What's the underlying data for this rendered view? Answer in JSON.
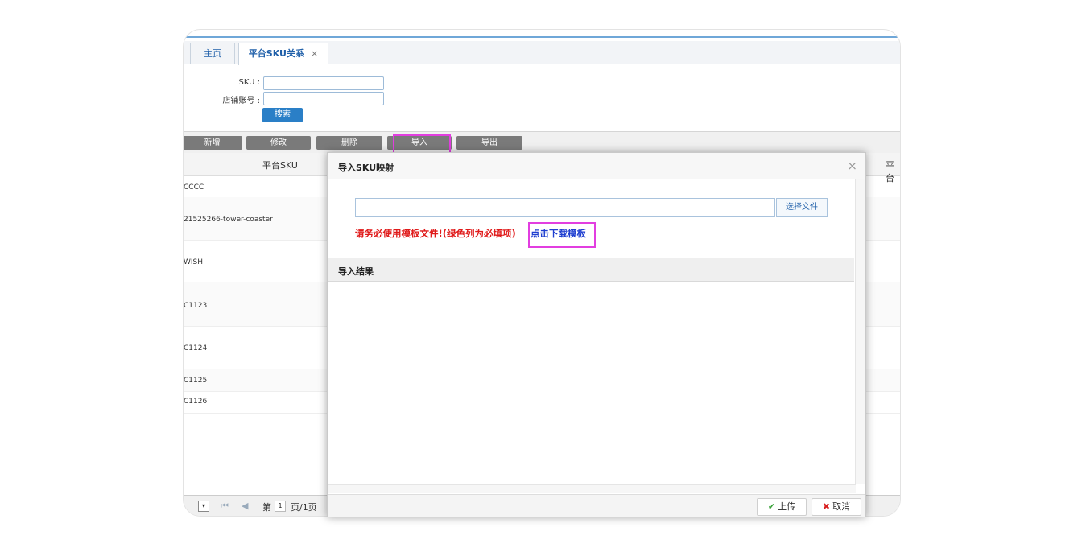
{
  "tabs": [
    {
      "label": "主页"
    },
    {
      "label": "平台SKU关系",
      "close": "×"
    }
  ],
  "search": {
    "sku_label": "SKU :",
    "shop_label": "店铺账号 :",
    "search_button": "搜索"
  },
  "toolbar": {
    "add": "新增",
    "edit": "修改",
    "delete": "删除",
    "import": "导入",
    "export": "导出"
  },
  "grid": {
    "col_platform_sku": "平台SKU",
    "col_right": "平台",
    "rows": [
      "CCCC",
      "21525266-tower-coaster",
      "WISH",
      "C1123",
      "C1124",
      "C1125",
      "C1126"
    ]
  },
  "pager": {
    "page_prefix": "第",
    "page_value": "1",
    "page_suffix": "页/1页"
  },
  "dialog": {
    "title": "导入SKU映射",
    "close": "×",
    "choose_file": "选择文件",
    "warning": "请务必使用模板文件!(绿色列为必填项)",
    "download_link": "点击下载模板",
    "result_title": "导入结果",
    "upload_button": "上传",
    "cancel_button": "取消"
  },
  "colors": {
    "accent": "#2a7fc7",
    "highlight": "#e23ee0",
    "warning": "#e01a1a",
    "link": "#1f3fd0"
  }
}
